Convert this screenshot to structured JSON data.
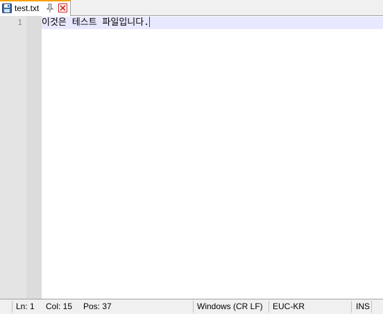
{
  "tab": {
    "label": "test.txt",
    "icon": "save-icon",
    "pin_icon": "pin-icon",
    "close_icon": "close-icon"
  },
  "editor": {
    "line_number": "1",
    "text": "이것은 테스트 파일입니다."
  },
  "statusbar": {
    "ln": "Ln: 1",
    "col": "Col: 15",
    "pos": "Pos: 37",
    "eol": "Windows (CR LF)",
    "encoding": "EUC-KR",
    "mode": "INS"
  },
  "colors": {
    "current_line_bg": "#e8e8ff",
    "caret": "#8000ff",
    "tab_accent": "#f8a000",
    "close_icon": "#d02020"
  }
}
